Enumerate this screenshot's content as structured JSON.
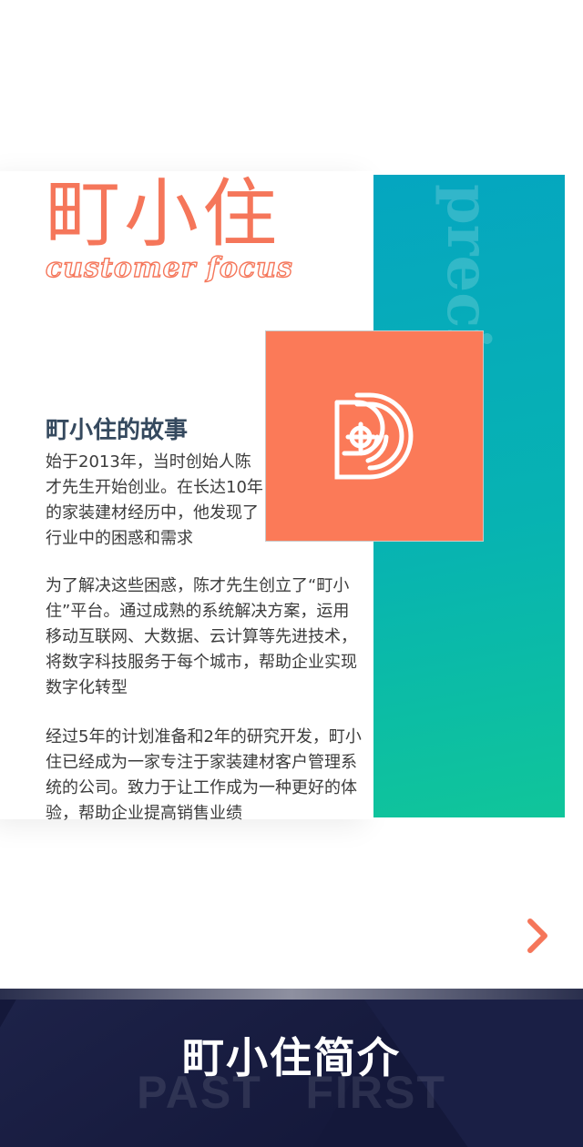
{
  "brand": {
    "title": "町小住",
    "subtitle": "customer focus"
  },
  "panel": {
    "watermark": "precious"
  },
  "story": {
    "title": "町小住的故事",
    "paragraph_1": "始于2013年，当时创始人陈才先生开始创业。在长达10年的家装建材经历中，他发现了行业中的困惑和需求",
    "paragraph_2": "为了解决这些困惑，陈才先生创立了“町小住”平台。通过成熟的系统解决方案，运用移动互联网、大数据、云计算等先进技术，将数字科技服务于每个城市，帮助企业实现数字化转型",
    "paragraph_3": "经过5年的计划准备和2年的研究开发，町小住已经成为一家专注于家装建材客户管理系统的公司。致力于让工作成为一种更好的体验，帮助企业提高销售业绩"
  },
  "icons": {
    "logo": "brand-logo-icon",
    "next": "chevron-right-icon"
  },
  "footer": {
    "title": "町小住简介",
    "watermark": "PAST   FIRST"
  },
  "colors": {
    "accent": "#f5765a",
    "logo_bg": "#fb7a58",
    "teal_top": "#05a6c0",
    "teal_bottom": "#10c59a",
    "footer_bg": "#14183a",
    "heading": "#35495e"
  }
}
